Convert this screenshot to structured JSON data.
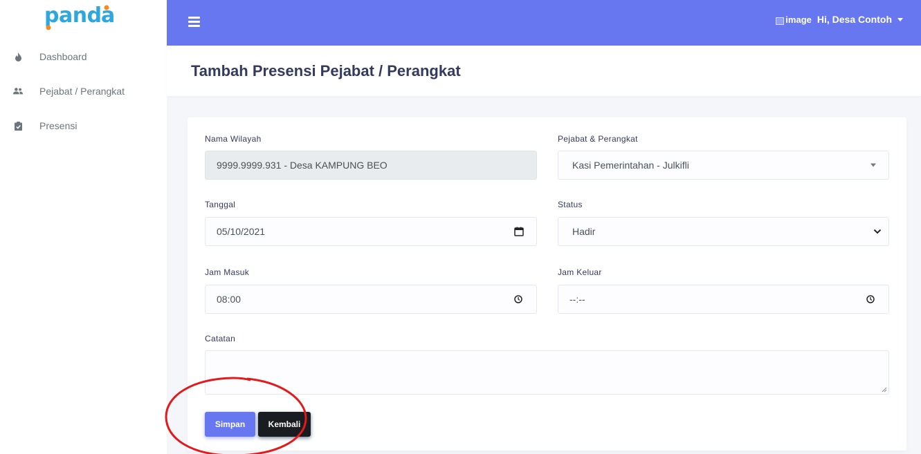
{
  "sidebar": {
    "brand": "panda",
    "items": [
      {
        "label": "Dashboard",
        "icon": "fire-icon"
      },
      {
        "label": "Pejabat / Perangkat",
        "icon": "users-icon"
      },
      {
        "label": "Presensi",
        "icon": "clipboard-check-icon"
      }
    ]
  },
  "navbar": {
    "user_image_alt": "image",
    "user_greeting": "Hi, Desa Contoh",
    "accent_color": "#6777ef"
  },
  "page": {
    "title": "Tambah Presensi Pejabat / Perangkat"
  },
  "form": {
    "nama_wilayah": {
      "label": "Nama Wilayah",
      "value": "9999.9999.931 - Desa KAMPUNG BEO"
    },
    "pejabat": {
      "label": "Pejabat & Perangkat",
      "value": "Kasi Pemerintahan - Julkifli"
    },
    "tanggal": {
      "label": "Tanggal",
      "value": "05/10/2021"
    },
    "status": {
      "label": "Status",
      "value": "Hadir"
    },
    "jam_masuk": {
      "label": "Jam Masuk",
      "value": "08:00"
    },
    "jam_keluar": {
      "label": "Jam Keluar",
      "value": "--:--"
    },
    "catatan": {
      "label": "Catatan",
      "value": ""
    }
  },
  "buttons": {
    "save": "Simpan",
    "back": "Kembali"
  },
  "annotation_color": "#e31a1c"
}
